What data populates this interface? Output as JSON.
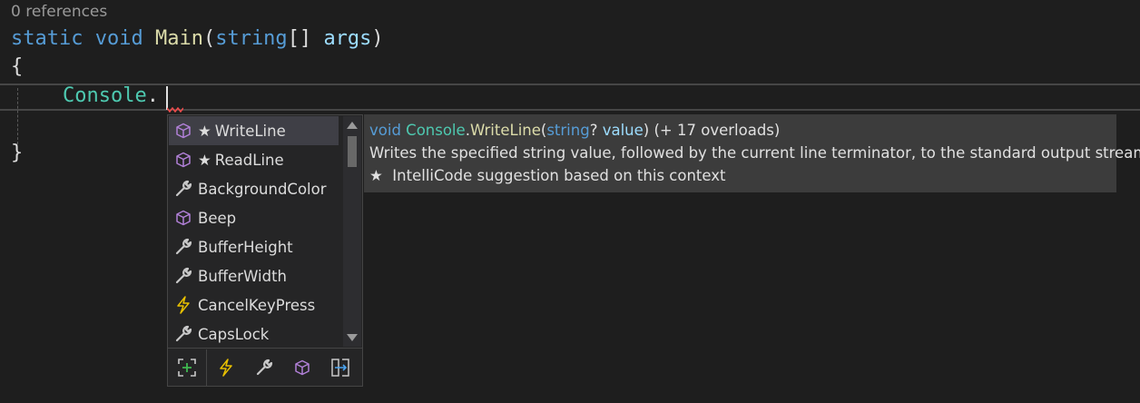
{
  "editor": {
    "codelens": "0 references",
    "line1": {
      "kw1": "static",
      "kw2": "void",
      "fn": "Main",
      "paren_open": "(",
      "type": "string",
      "brackets": "[]",
      "param": "args",
      "paren_close": ")"
    },
    "brace_open": "{",
    "line3": {
      "cls": "Console",
      "dot": "."
    },
    "brace_close": "}"
  },
  "completion": {
    "items": [
      {
        "label": "WriteLine",
        "star": "★",
        "icon": "method-icon"
      },
      {
        "label": "ReadLine",
        "star": "★",
        "icon": "method-icon"
      },
      {
        "label": "BackgroundColor",
        "icon": "property-icon"
      },
      {
        "label": "Beep",
        "icon": "method-icon"
      },
      {
        "label": "BufferHeight",
        "icon": "property-icon"
      },
      {
        "label": "BufferWidth",
        "icon": "property-icon"
      },
      {
        "label": "CancelKeyPress",
        "icon": "event-icon"
      },
      {
        "label": "CapsLock",
        "icon": "property-icon"
      }
    ],
    "selected_index": 0,
    "filters": [
      "snippets-filter-icon",
      "events-filter-icon",
      "properties-filter-icon",
      "methods-filter-icon",
      "extension-methods-filter-icon"
    ]
  },
  "tooltip": {
    "sig_kw": "void",
    "sig_cls": "Console",
    "sig_dot": ".",
    "sig_fn": "WriteLine",
    "sig_open": "(",
    "sig_type": "string",
    "sig_q": "?",
    "sig_param": "value",
    "sig_close": ")",
    "overloads": "(+ 17 overloads)",
    "description": "Writes the specified string value, followed by the current line terminator, to the standard output stream.",
    "intellicode_star": "★",
    "intellicode": "IntelliCode suggestion based on this context"
  },
  "colors": {
    "method": "#b180d7",
    "property": "#c8c8c8",
    "event": "#e8c000",
    "keyword": "#569cd6",
    "class": "#4ec9b0"
  }
}
